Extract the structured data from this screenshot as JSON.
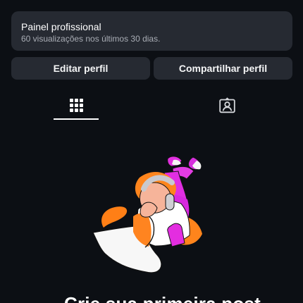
{
  "status_fragment": "•• ·· · ·",
  "dashboard": {
    "title": "Painel profissional",
    "subtitle": "60 visualizações nos últimos 30 dias."
  },
  "actions": {
    "edit_label": "Editar perfil",
    "share_label": "Compartilhar perfil"
  },
  "tabs": [
    {
      "name": "grid-icon",
      "selected": true
    },
    {
      "name": "tagged-person-icon",
      "selected": false
    }
  ],
  "empty_state": {
    "title_partial": "Crie sua primeira post"
  },
  "colors": {
    "background": "#0c0f14",
    "surface": "#262a32",
    "text": "#ffffff",
    "muted": "#a9adb5",
    "orange": "#ff8a1f",
    "magenta": "#d12be0",
    "skin": "#f7b493",
    "gray": "#d8d8dd"
  }
}
